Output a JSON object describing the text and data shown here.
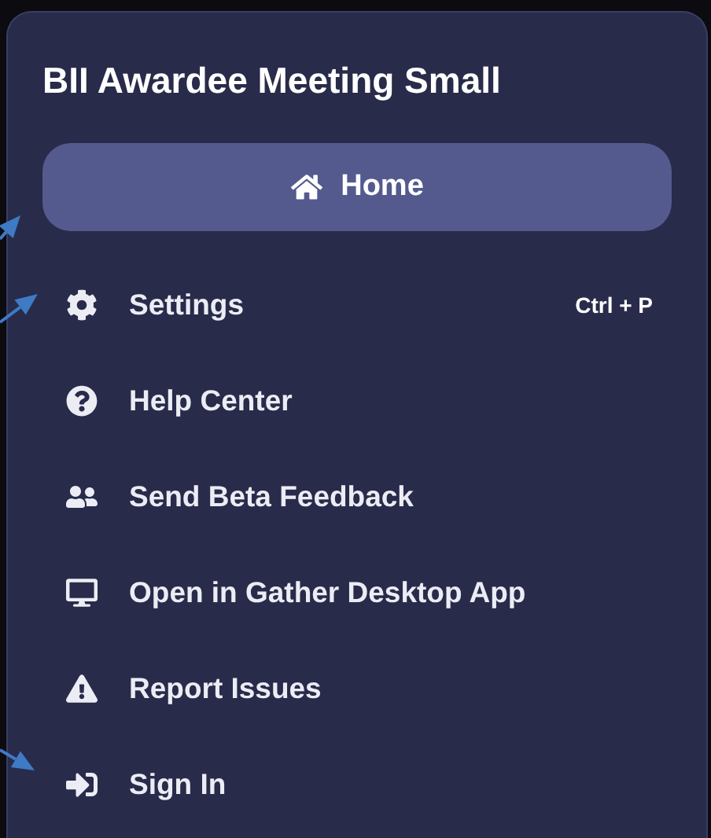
{
  "panel": {
    "title": "BII Awardee Meeting Small"
  },
  "menu": {
    "items": [
      {
        "label": "Home",
        "selected": true
      },
      {
        "label": "Settings",
        "selected": false,
        "shortcut": "Ctrl + P"
      },
      {
        "label": "Help Center",
        "selected": false
      },
      {
        "label": "Send Beta Feedback",
        "selected": false
      },
      {
        "label": "Open in Gather Desktop App",
        "selected": false
      },
      {
        "label": "Report Issues",
        "selected": false
      },
      {
        "label": "Sign In",
        "selected": false
      }
    ]
  }
}
